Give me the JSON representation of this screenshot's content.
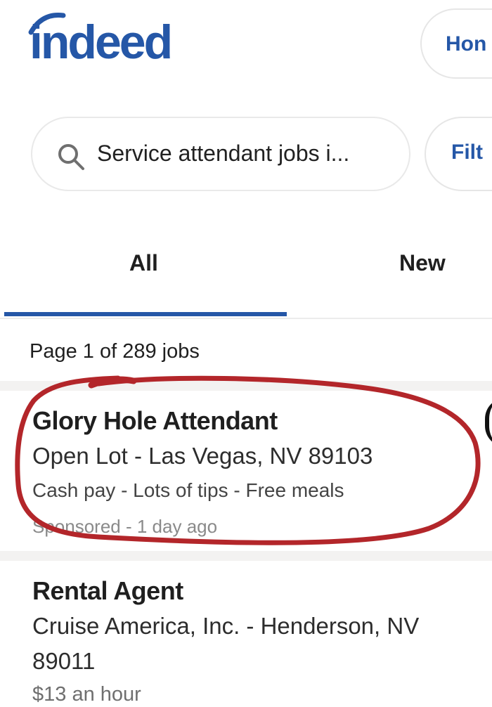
{
  "header": {
    "logo_text": "indeed",
    "home_label": "Hon"
  },
  "search": {
    "query": "Service attendant jobs i...",
    "filter_label": "Filt"
  },
  "tabs": [
    {
      "label": "All",
      "selected": true
    },
    {
      "label": "New",
      "selected": false
    }
  ],
  "results": {
    "page_info": "Page 1 of 289 jobs"
  },
  "jobs": [
    {
      "title": "Glory Hole Attendant",
      "company_location": "Open Lot - Las Vegas, NV 89103",
      "snippet": "Cash pay - Lots of tips - Free meals",
      "meta": "Sponsored - 1 day ago"
    },
    {
      "title": "Rental Agent",
      "company_location_line1": "Cruise America, Inc. - Henderson, NV",
      "company_location_line2": "89011",
      "pay": "$13 an hour"
    }
  ],
  "colors": {
    "brand": "#2557a7",
    "annotation": "#b3262a"
  }
}
